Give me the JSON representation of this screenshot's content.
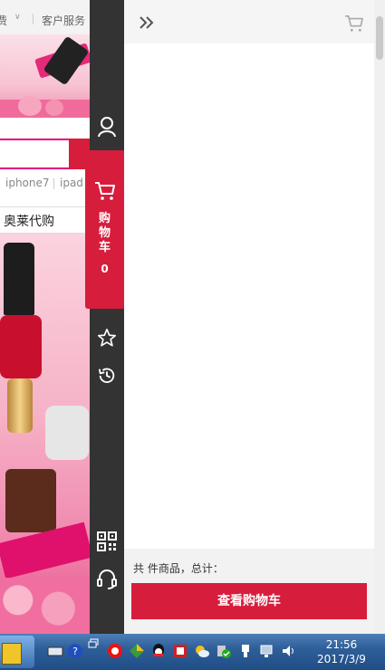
{
  "page": {
    "topbar": {
      "left_text": "费",
      "service": "客户服务"
    },
    "hot_words": [
      "iphone7",
      "ipad"
    ],
    "nav_item": "奥莱代购"
  },
  "sidebar": {
    "items": [
      {
        "name": "user-icon"
      },
      {
        "name": "cart-icon",
        "label": "购物车",
        "count": "0",
        "active": true
      },
      {
        "name": "star-icon"
      },
      {
        "name": "history-icon"
      },
      {
        "name": "qrcode-icon"
      },
      {
        "name": "headset-icon"
      }
    ],
    "cart_label_chars": [
      "购",
      "物",
      "车"
    ],
    "accent": "#d71d3c",
    "bg": "#333333"
  },
  "cart_panel": {
    "collapse_icon": "double-chevron-right-icon",
    "header_icon": "cart-icon",
    "summary_text": "共  件商品，总计：",
    "view_cart_button": "查看购物车"
  },
  "taskbar": {
    "time": "21:56",
    "date": "2017/3/9",
    "tray_icons": [
      "keyboard-icon",
      "help-icon",
      "restore-icon",
      "app-red-icon",
      "app-color-icon",
      "qq-icon",
      "app-flag-icon",
      "weather-icon",
      "security-shield-icon",
      "usb-icon",
      "network-icon",
      "volume-icon"
    ]
  }
}
